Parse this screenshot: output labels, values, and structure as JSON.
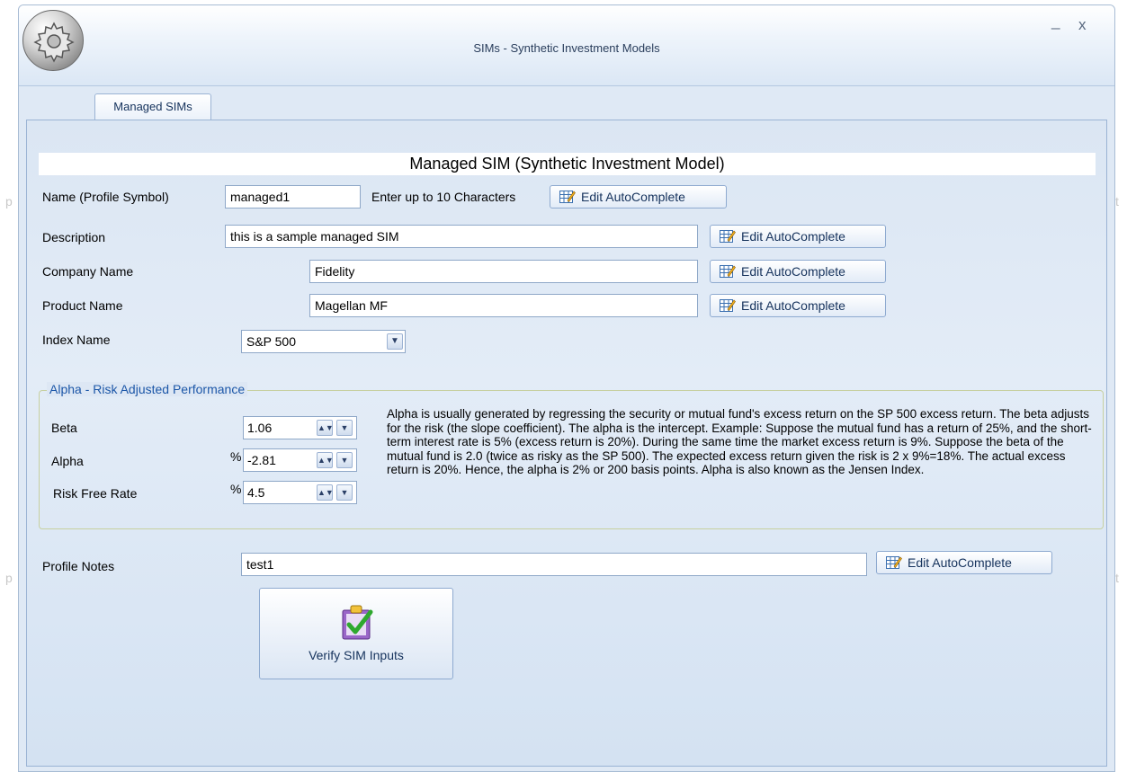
{
  "window": {
    "title": "SIMs - Synthetic Investment Models",
    "minimize_symbol": "_",
    "close_symbol": "x"
  },
  "tabs": [
    {
      "label": "Managed SIMs",
      "active": true
    }
  ],
  "form": {
    "header": "Managed SIM (Synthetic Investment Model)",
    "name_label": "Name (Profile Symbol)",
    "name_value": "managed1",
    "name_hint": "Enter up to 10 Characters",
    "description_label": "Description",
    "description_value": "this is a sample managed SIM",
    "company_label": "Company Name",
    "company_value": "Fidelity",
    "product_label": "Product Name",
    "product_value": "Magellan MF",
    "index_label": "Index Name",
    "index_value": "S&P 500",
    "edit_autocomplete_label": "Edit AutoComplete"
  },
  "alpha_group": {
    "title": "Alpha - Risk Adjusted Performance",
    "beta_label": "Beta",
    "beta_value": "1.06",
    "alpha_label": "Alpha",
    "alpha_value": "-2.81",
    "risk_free_label": "Risk Free Rate",
    "risk_free_value": "4.5",
    "percent_symbol": "%",
    "explanation": "Alpha is usually generated by regressing the security or mutual fund's excess return on the SP 500 excess return. The beta adjusts for the risk (the slope coefficient). The alpha is the intercept. Example: Suppose the mutual fund has a return of 25%, and the short-term interest rate is 5% (excess return is 20%). During the same time the market excess return is 9%. Suppose the beta of the mutual fund is 2.0 (twice as risky as the SP 500). The expected excess return given the risk is 2 x 9%=18%. The actual excess return is 20%. Hence, the alpha is 2% or 200 basis points. Alpha is also known as the Jensen Index."
  },
  "notes": {
    "label": "Profile Notes",
    "value": "test1"
  },
  "verify_button": {
    "label": "Verify SIM Inputs"
  },
  "colors": {
    "accent": "#1c57a8",
    "panel": "#dfe9f5",
    "border": "#9ab3d4"
  },
  "icons": {
    "app": "gear-icon",
    "edit": "table-edit-icon",
    "verify": "clipboard-check-icon"
  }
}
